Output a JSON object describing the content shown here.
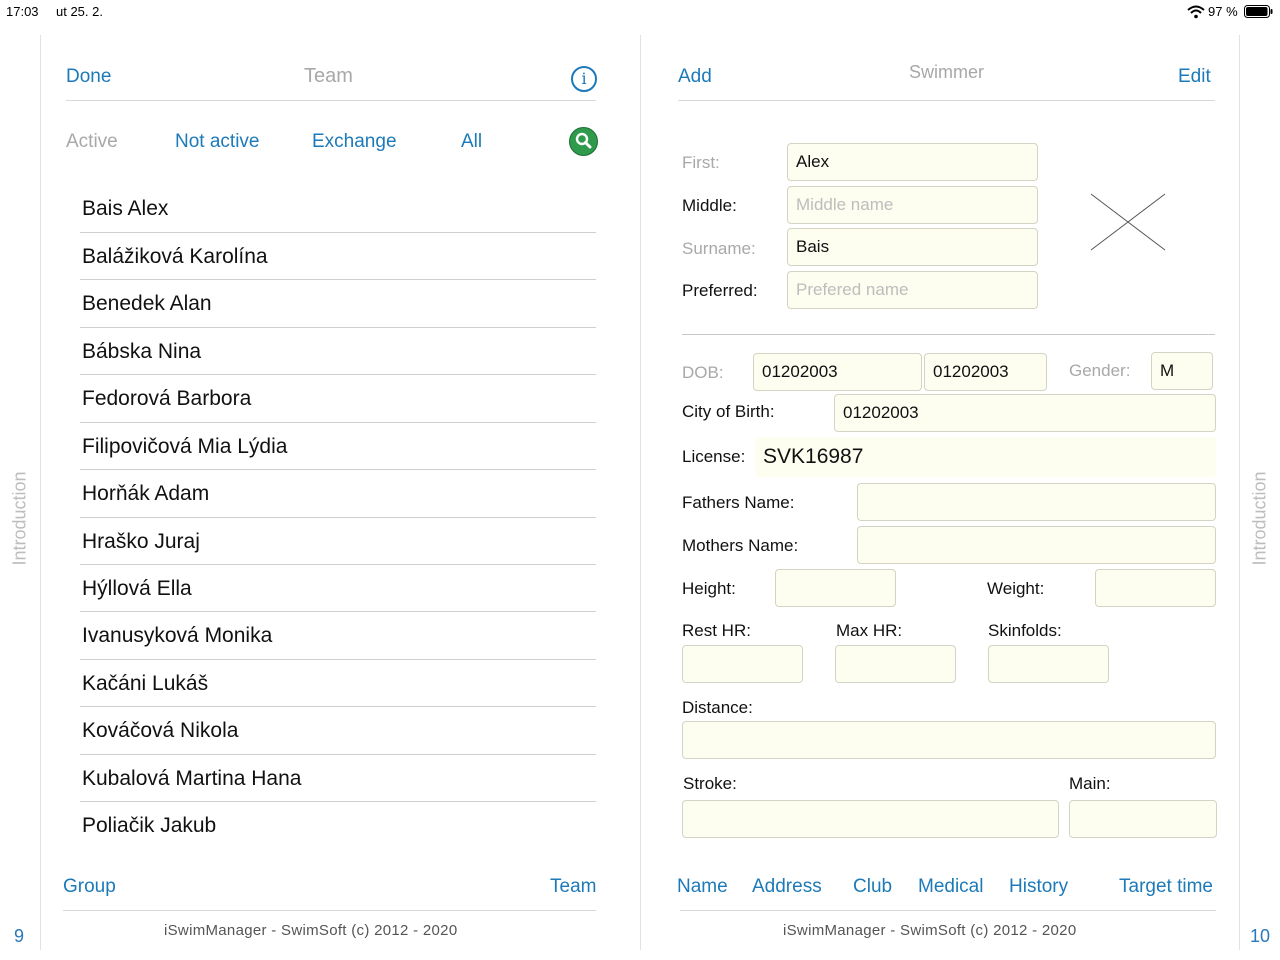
{
  "status_bar": {
    "time": "17:03",
    "date": "ut 25. 2.",
    "battery": "97 %"
  },
  "left_page": {
    "done": "Done",
    "title": "Team",
    "filters": [
      "Active",
      "Not active",
      "Exchange",
      "All"
    ],
    "swimmers": [
      "Bais  Alex",
      "Balážiková  Karolína",
      "Benedek  Alan",
      "Bábska  Nina",
      "Fedorová  Barbora",
      "Filipovičová  Mia Lýdia",
      "Horňák  Adam",
      "Hraško  Juraj",
      "Hýllová  Ella",
      "Ivanusyková  Monika",
      "Kačáni  Lukáš",
      "Kováčová  Nikola",
      "Kubalová  Martina Hana",
      "Poliačik  Jakub"
    ],
    "bottom_left": "Group",
    "bottom_right": "Team",
    "footer": "iSwimManager - SwimSoft (c) 2012 - 2020",
    "side_label": "Introduction",
    "page_number": "9"
  },
  "right_page": {
    "add": "Add",
    "title": "Swimmer",
    "edit": "Edit",
    "labels": {
      "first": "First:",
      "middle": "Middle:",
      "surname": "Surname:",
      "preferred": "Preferred:",
      "dob": "DOB:",
      "gender": "Gender:",
      "city_of_birth": "City of Birth:",
      "license": "License:",
      "fathers_name": "Fathers Name:",
      "mothers_name": "Mothers Name:",
      "height": "Height:",
      "weight": "Weight:",
      "rest_hr": "Rest HR:",
      "max_hr": "Max HR:",
      "skinfolds": "Skinfolds:",
      "distance": "Distance:",
      "stroke": "Stroke:",
      "main": "Main:"
    },
    "values": {
      "first": "Alex",
      "middle_placeholder": "Middle name",
      "surname": "Bais",
      "preferred_placeholder": "Prefered name",
      "dob_1": "01202003",
      "dob_2": "01202003",
      "gender": "M",
      "city_of_birth": "01202003",
      "license": "SVK16987"
    },
    "tabs": [
      "Name",
      "Address",
      "Club",
      "Medical",
      "History",
      "Target time"
    ],
    "footer": "iSwimManager - SwimSoft (c) 2012 - 2020",
    "side_label": "Introduction",
    "page_number": "10"
  }
}
